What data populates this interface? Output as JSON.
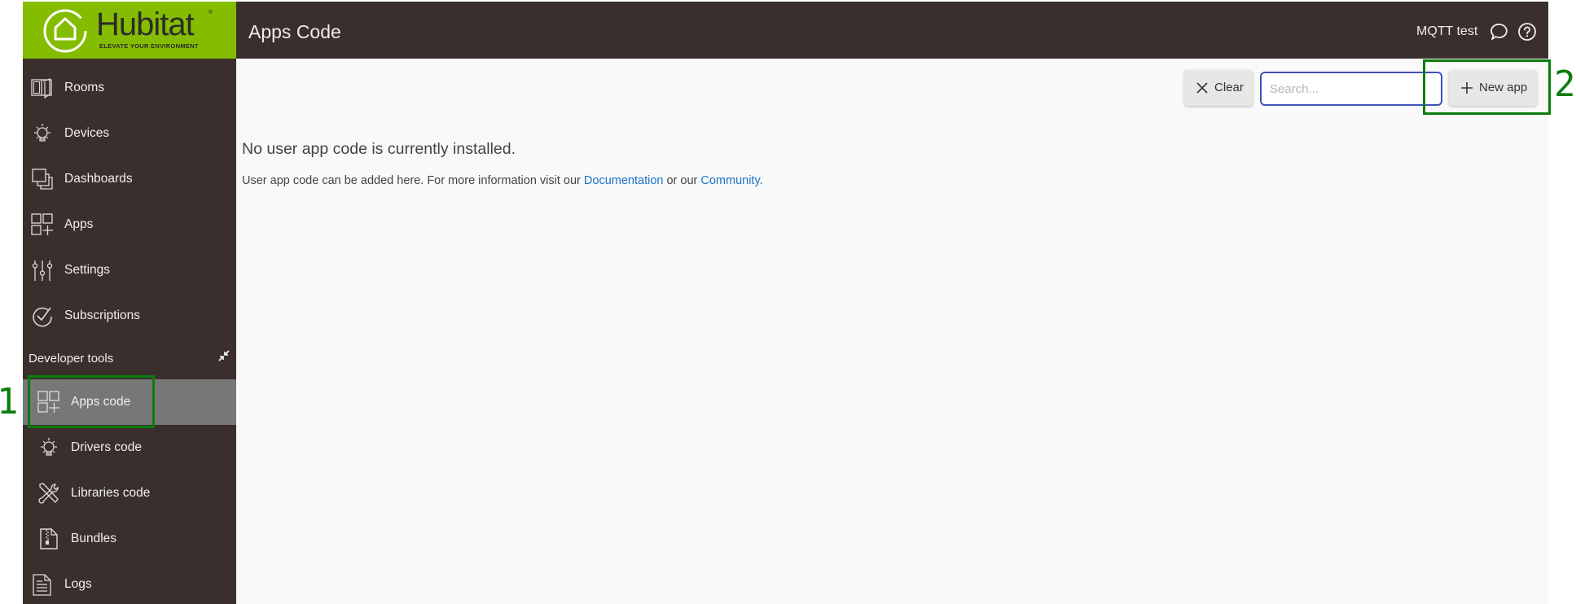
{
  "header": {
    "brand": "Hubitat",
    "brand_mark": "®",
    "tagline": "ELEVATE YOUR ENVIRONMENT",
    "page_title": "Apps Code",
    "hub_name": "MQTT test",
    "icons": [
      "chat-icon",
      "help-icon"
    ]
  },
  "sidebar": {
    "items": [
      {
        "label": "Rooms",
        "icon": "rooms-icon"
      },
      {
        "label": "Devices",
        "icon": "lightbulb-icon"
      },
      {
        "label": "Dashboards",
        "icon": "dashboards-icon"
      },
      {
        "label": "Apps",
        "icon": "apps-icon"
      },
      {
        "label": "Settings",
        "icon": "sliders-icon"
      },
      {
        "label": "Subscriptions",
        "icon": "check-circle-icon"
      }
    ],
    "section_title": "Developer tools",
    "dev_items": [
      {
        "label": "Apps code",
        "icon": "apps-icon",
        "active": true
      },
      {
        "label": "Drivers code",
        "icon": "lightbulb-icon"
      },
      {
        "label": "Libraries code",
        "icon": "tools-icon"
      },
      {
        "label": "Bundles",
        "icon": "zip-file-icon"
      },
      {
        "label": "Logs",
        "icon": "document-icon"
      }
    ]
  },
  "toolbar": {
    "clear_label": "Clear",
    "search_placeholder": "Search...",
    "search_value": "",
    "new_app_label": "New app"
  },
  "content": {
    "empty_title": "No user app code is currently installed.",
    "desc_prefix": "User app code can be added here. For more information visit our ",
    "doc_link": "Documentation",
    "desc_middle": " or our ",
    "community_link": "Community",
    "desc_suffix": "."
  },
  "annotations": [
    {
      "label": "1",
      "target": "Apps code"
    },
    {
      "label": "2",
      "target": "New app"
    }
  ],
  "colors": {
    "brand_green": "#84bd00",
    "header_bg": "#3a2f2d",
    "active_item_bg": "#777777",
    "link": "#1a73c8",
    "search_border": "#3f51b5",
    "annotation": "#0a7d0a"
  }
}
